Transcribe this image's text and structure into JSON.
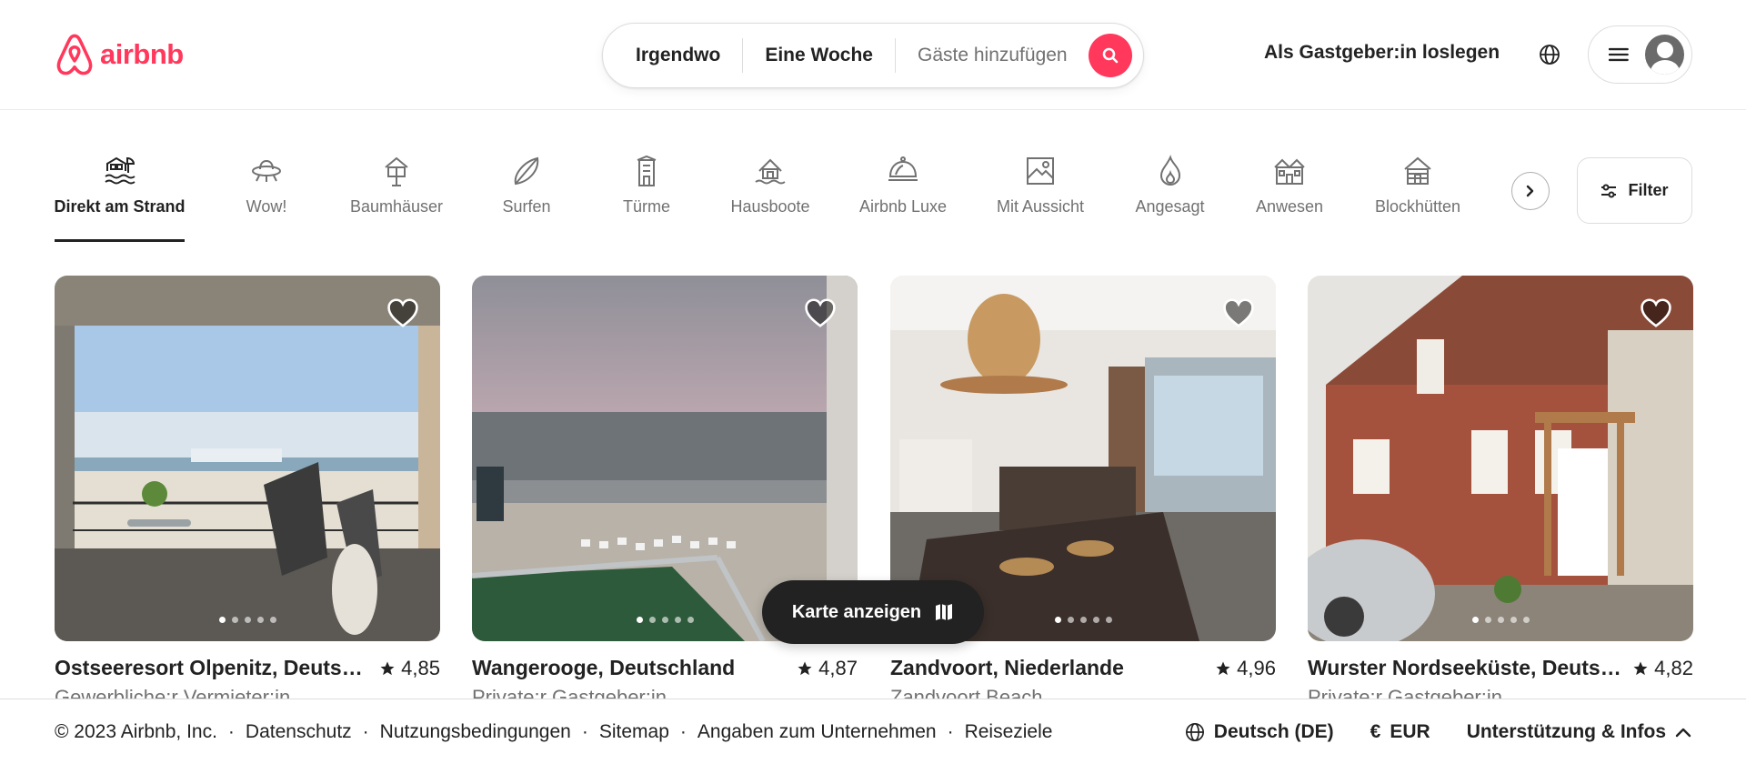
{
  "header": {
    "logo_text": "airbnb",
    "search": {
      "anywhere": "Irgendwo",
      "week": "Eine Woche",
      "guests": "Gäste hinzufügen"
    },
    "host_link": "Als Gastgeber:in loslegen",
    "brand_color": "#ff385c"
  },
  "categories": [
    {
      "label": "Direkt am Strand",
      "icon": "beach-icon",
      "active": true
    },
    {
      "label": "Wow!",
      "icon": "ufo-icon"
    },
    {
      "label": "Baumhäuser",
      "icon": "treehouse-icon"
    },
    {
      "label": "Surfen",
      "icon": "surfboard-icon"
    },
    {
      "label": "Türme",
      "icon": "tower-icon"
    },
    {
      "label": "Hausboote",
      "icon": "houseboat-icon"
    },
    {
      "label": "Airbnb Luxe",
      "icon": "luxe-icon"
    },
    {
      "label": "Mit Aussicht",
      "icon": "view-icon"
    },
    {
      "label": "Angesagt",
      "icon": "flame-icon"
    },
    {
      "label": "Anwesen",
      "icon": "mansion-icon"
    },
    {
      "label": "Blockhütten",
      "icon": "cabin-icon"
    }
  ],
  "filter_label": "Filter",
  "listings": [
    {
      "title": "Ostseeresort Olpenitz, Deutschland",
      "rating": "4,85",
      "subtitle": "Gewerbliche:r Vermieter:in"
    },
    {
      "title": "Wangerooge, Deutschland",
      "rating": "4,87",
      "subtitle": "Private:r Gastgeber:in"
    },
    {
      "title": "Zandvoort, Niederlande",
      "rating": "4,96",
      "subtitle": "Zandvoort Beach"
    },
    {
      "title": "Wurster Nordseeküste, Deutschland",
      "rating": "4,82",
      "subtitle": "Private:r Gastgeber:in"
    }
  ],
  "map_button": "Karte anzeigen",
  "footer": {
    "copyright": "© 2023 Airbnb, Inc.",
    "links": [
      "Datenschutz",
      "Nutzungsbedingungen",
      "Sitemap",
      "Angaben zum Unternehmen",
      "Reiseziele"
    ],
    "language": "Deutsch (DE)",
    "currency_symbol": "€",
    "currency": "EUR",
    "support": "Unterstützung & Infos"
  }
}
